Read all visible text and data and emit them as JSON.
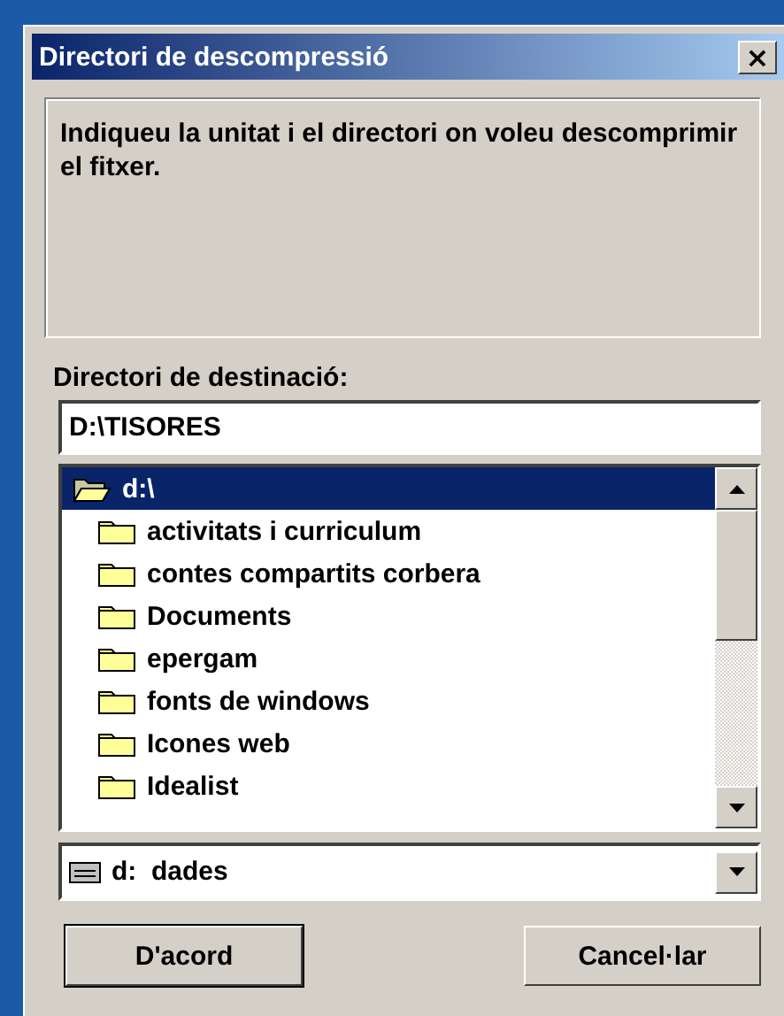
{
  "window": {
    "title": "Directori de descompressió",
    "close": "×"
  },
  "message": "Indiqueu la unitat i el directori on voleu descomprimir el fitxer.",
  "destination": {
    "label": "Directori de destinació:",
    "value": "D:\\TISORES"
  },
  "folders": [
    {
      "label": "d:\\",
      "selected": true,
      "expanded": true,
      "children": [
        {
          "label": "activitats i curriculum",
          "selected": false,
          "expanded": false
        },
        {
          "label": "contes compartits corbera",
          "selected": false,
          "expanded": false
        },
        {
          "label": "Documents",
          "selected": false,
          "expanded": false
        },
        {
          "label": "epergam",
          "selected": false,
          "expanded": false
        },
        {
          "label": "fonts de windows",
          "selected": false,
          "expanded": false
        },
        {
          "label": "Icones web",
          "selected": false,
          "expanded": false
        },
        {
          "label": "Idealist",
          "selected": false,
          "expanded": false
        }
      ]
    }
  ],
  "drive": {
    "value": "d:  dades"
  },
  "buttons": [
    {
      "label": "D'acord",
      "default": true
    },
    {
      "label": "Cancel·lar",
      "default": false
    }
  ]
}
